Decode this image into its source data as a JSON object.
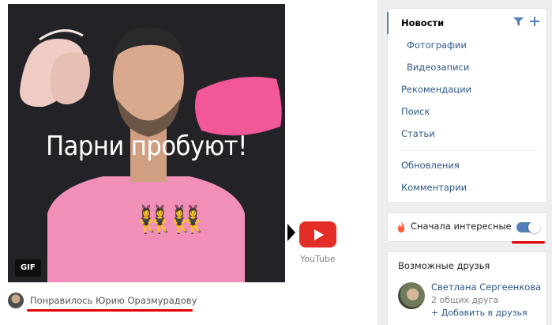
{
  "post": {
    "media_title": "Парни пробуют!",
    "gif_badge": "GIF",
    "emoji": "👯‍♀️👯‍♀️",
    "source_label": "YouTube",
    "liked_by_text": "Понравилось Юрию Оразмурадову"
  },
  "news_menu": {
    "items": [
      {
        "label": "Новости",
        "active": true
      },
      {
        "label": "Фотографии",
        "sub": true
      },
      {
        "label": "Видеозаписи",
        "sub": true
      },
      {
        "label": "Рекомендации"
      },
      {
        "label": "Поиск"
      },
      {
        "label": "Статьи"
      },
      {
        "label": "Обновления"
      },
      {
        "label": "Комментарии"
      }
    ],
    "icons": [
      "filter-icon",
      "plus-icon"
    ]
  },
  "interesting_first": {
    "label": "Сначала интересные",
    "enabled": true,
    "icon": "fire-icon"
  },
  "suggested_friends": {
    "title": "Возможные друзья",
    "friend": {
      "name": "Светлана Сергеенкова",
      "mutual": "2 общих друга",
      "add_label": "+ Добавить в друзья"
    }
  },
  "colors": {
    "link": "#2a5885",
    "accent": "#5181b8",
    "annotation_red": "#e00000",
    "youtube_red": "#e52d27",
    "shirt_pink": "#f28fb8"
  }
}
